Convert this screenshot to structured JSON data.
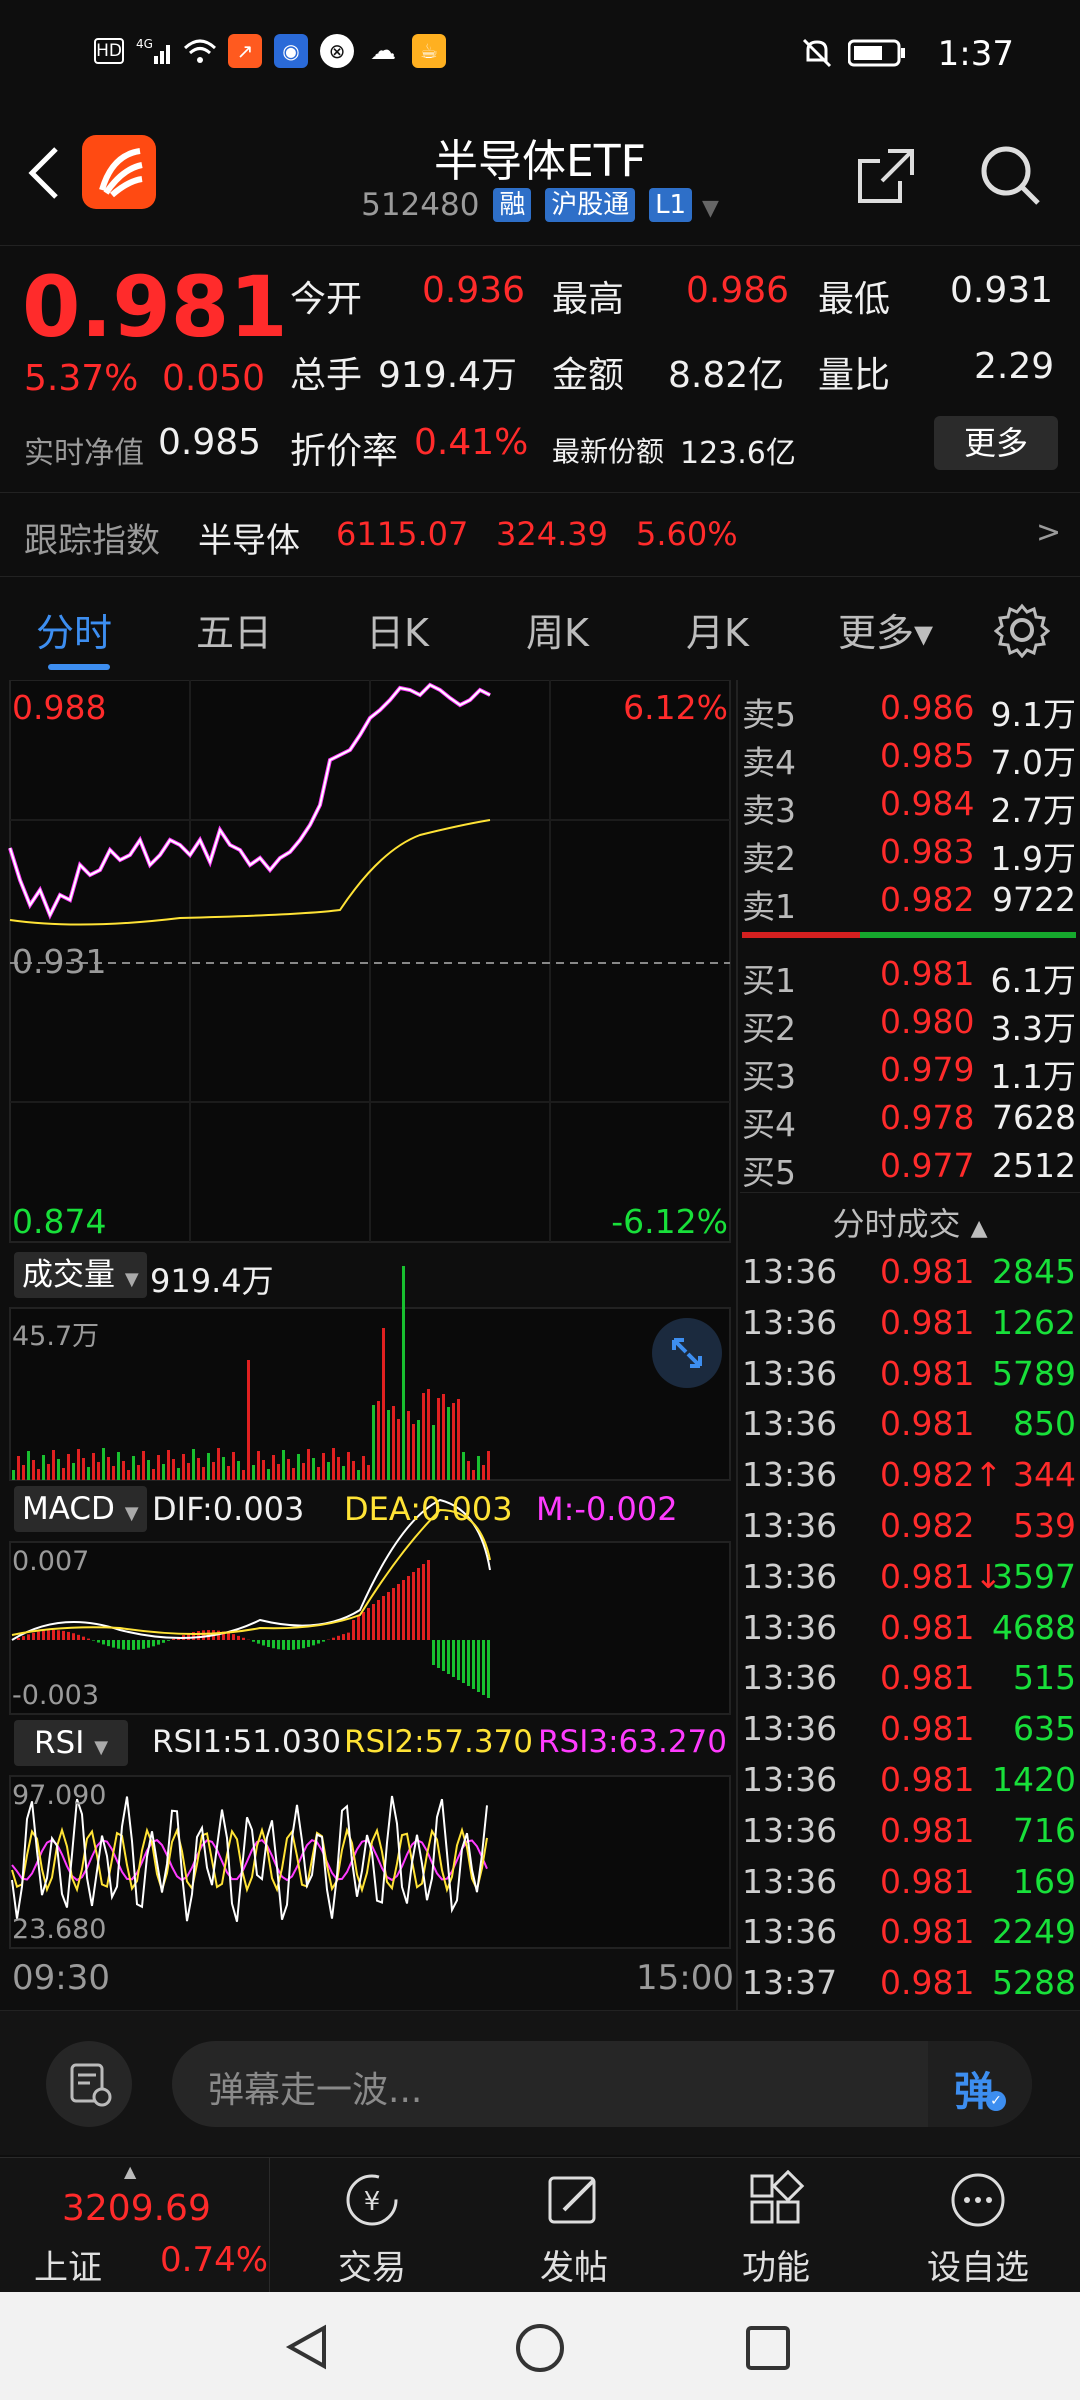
{
  "status_bar": {
    "time": "1:37",
    "left_icons": [
      "HD",
      "4G-signal-icon",
      "wifi-icon",
      "app-icon-1",
      "app-icon-2",
      "app-icon-3",
      "wechat-icon",
      "app-icon-4"
    ]
  },
  "header": {
    "title": "半导体ETF",
    "code": "512480",
    "tags": [
      "融",
      "沪股通",
      "L1"
    ]
  },
  "quote": {
    "price": "0.981",
    "change_pct": "5.37%",
    "change": "0.050",
    "open_label": "今开",
    "open": "0.936",
    "high_label": "最高",
    "high": "0.986",
    "low_label": "最低",
    "low": "0.931",
    "volume_label": "总手",
    "volume": "919.4万",
    "amount_label": "金额",
    "amount": "8.82亿",
    "ratio_label": "量比",
    "ratio": "2.29",
    "nav_label": "实时净值",
    "nav": "0.985",
    "discount_label": "折价率",
    "discount": "0.41%",
    "shares_label": "最新份额",
    "shares": "123.6亿",
    "more_label": "更多"
  },
  "index_row": {
    "label": "跟踪指数",
    "name": "半导体",
    "value": "6115.07",
    "change": "324.39",
    "change_pct": "5.60%",
    "arrow": ">"
  },
  "tabs": [
    "分时",
    "五日",
    "日K",
    "周K",
    "月K",
    "更多▾"
  ],
  "chart": {
    "price_top": "0.988",
    "price_mid": "0.931",
    "price_bottom": "0.874",
    "pct_top": "6.12%",
    "pct_bottom": "-6.12%",
    "volume_selector": "成交量",
    "volume_total": "919.4万",
    "volume_max": "45.7万",
    "macd_selector": "MACD",
    "dif": "DIF:0.003",
    "dea": "DEA:0.003",
    "m": "M:-0.002",
    "macd_top": "0.007",
    "macd_bottom": "-0.003",
    "rsi_selector": "RSI",
    "rsi1": "RSI1:51.030",
    "rsi2": "RSI2:57.370",
    "rsi3": "RSI3:63.270",
    "rsi_top": "97.090",
    "rsi_bottom": "23.680",
    "time_start": "09:30",
    "time_end": "15:00"
  },
  "order_book": {
    "asks": [
      {
        "label": "卖5",
        "price": "0.986",
        "vol": "9.1万"
      },
      {
        "label": "卖4",
        "price": "0.985",
        "vol": "7.0万"
      },
      {
        "label": "卖3",
        "price": "0.984",
        "vol": "2.7万"
      },
      {
        "label": "卖2",
        "price": "0.983",
        "vol": "1.9万"
      },
      {
        "label": "卖1",
        "price": "0.982",
        "vol": "9722"
      }
    ],
    "bids": [
      {
        "label": "买1",
        "price": "0.981",
        "vol": "6.1万"
      },
      {
        "label": "买2",
        "price": "0.980",
        "vol": "3.3万"
      },
      {
        "label": "买3",
        "price": "0.979",
        "vol": "1.1万"
      },
      {
        "label": "买4",
        "price": "0.978",
        "vol": "7628"
      },
      {
        "label": "买5",
        "price": "0.977",
        "vol": "2512"
      }
    ]
  },
  "trades": {
    "title": "分时成交",
    "rows": [
      {
        "time": "13:36",
        "price": "0.981",
        "vol": "2845",
        "color": "green"
      },
      {
        "time": "13:36",
        "price": "0.981",
        "vol": "1262",
        "color": "green"
      },
      {
        "time": "13:36",
        "price": "0.981",
        "vol": "5789",
        "color": "green"
      },
      {
        "time": "13:36",
        "price": "0.981",
        "vol": "850",
        "color": "green"
      },
      {
        "time": "13:36",
        "price": "0.982↑",
        "vol": "344",
        "color": "red"
      },
      {
        "time": "13:36",
        "price": "0.982",
        "vol": "539",
        "color": "red"
      },
      {
        "time": "13:36",
        "price": "0.981↓",
        "vol": "3597",
        "color": "green"
      },
      {
        "time": "13:36",
        "price": "0.981",
        "vol": "4688",
        "color": "green"
      },
      {
        "time": "13:36",
        "price": "0.981",
        "vol": "515",
        "color": "green"
      },
      {
        "time": "13:36",
        "price": "0.981",
        "vol": "635",
        "color": "green"
      },
      {
        "time": "13:36",
        "price": "0.981",
        "vol": "1420",
        "color": "green"
      },
      {
        "time": "13:36",
        "price": "0.981",
        "vol": "716",
        "color": "green"
      },
      {
        "time": "13:36",
        "price": "0.981",
        "vol": "169",
        "color": "green"
      },
      {
        "time": "13:36",
        "price": "0.981",
        "vol": "2249",
        "color": "green"
      },
      {
        "time": "13:37",
        "price": "0.981",
        "vol": "5288",
        "color": "green"
      }
    ]
  },
  "danmu": {
    "placeholder": "弹幕走一波...",
    "button": "弹"
  },
  "bottom_nav": {
    "index_value": "3209.69",
    "index_name": "上证",
    "index_pct": "0.74%",
    "items": [
      "交易",
      "发帖",
      "功能",
      "设自选"
    ]
  },
  "colors": {
    "up": "#ff2b2b",
    "down": "#18e03a",
    "accent": "#3d8ef0",
    "avg_line": "#ffe336",
    "macd_dea": "#ffe336",
    "macd_m": "#ff3cff"
  }
}
